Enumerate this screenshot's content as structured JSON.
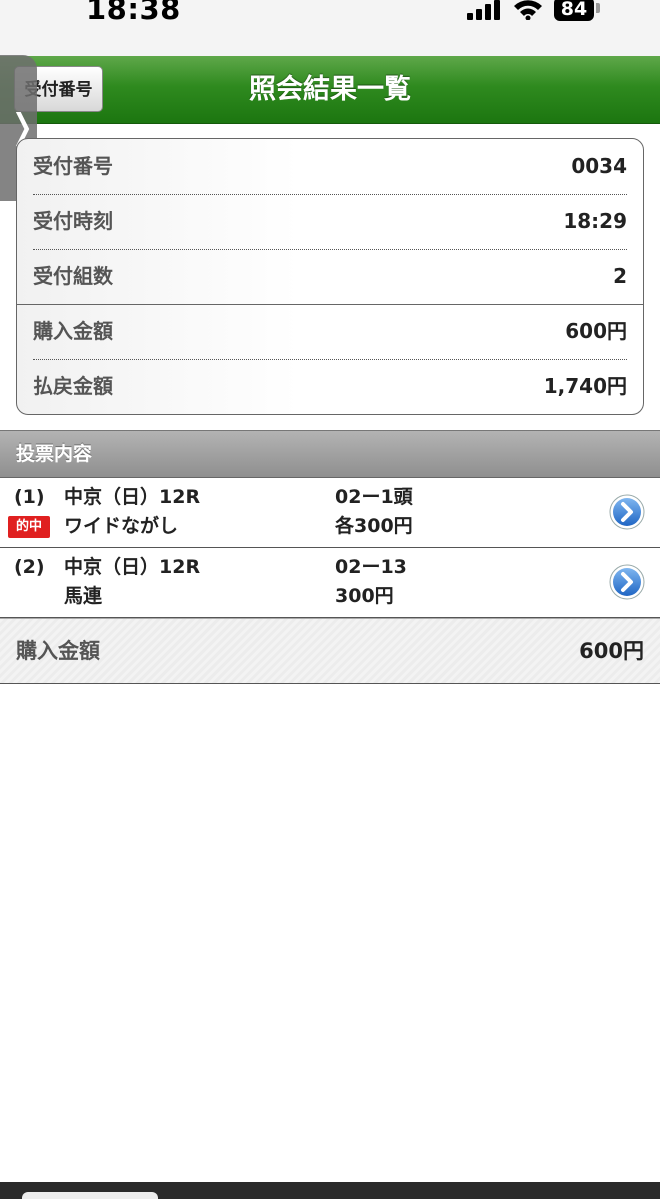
{
  "status_bar": {
    "time": "18:38",
    "battery": "84",
    "icons": [
      "signal-icon",
      "wifi-icon",
      "battery-icon"
    ]
  },
  "header": {
    "title": "照会結果一覧",
    "back_button_label": "受付番号"
  },
  "drawer": {
    "icon": "chevron-right-icon"
  },
  "info": {
    "receipt_number_label": "受付番号",
    "receipt_number": "0034",
    "receipt_time_label": "受付時刻",
    "receipt_time": "18:29",
    "bet_count_label": "受付組数",
    "bet_count": "2",
    "purchase_amount_label": "購入金額",
    "purchase_amount": "600円",
    "payout_amount_label": "払戻金額",
    "payout_amount": "1,740円"
  },
  "section": {
    "title": "投票内容"
  },
  "bets": [
    {
      "number": "(1)",
      "race": "中京（日）12R",
      "bet_type": "ワイドながし",
      "combination": "02ー1頭",
      "amount": "各300円",
      "badge": "的中",
      "icon": "chevron-right-circle-icon"
    },
    {
      "number": "(2)",
      "race": "中京（日）12R",
      "bet_type": "馬連",
      "combination": "02ー13",
      "amount": "300円",
      "icon": "chevron-right-circle-icon"
    }
  ],
  "total": {
    "label": "購入金額",
    "value": "600円"
  },
  "colors": {
    "header_green": "#2f8a1f",
    "hit_badge_red": "#e02020",
    "detail_button_blue": "#2f7fd8",
    "section_gray": "#9e9e9e"
  }
}
